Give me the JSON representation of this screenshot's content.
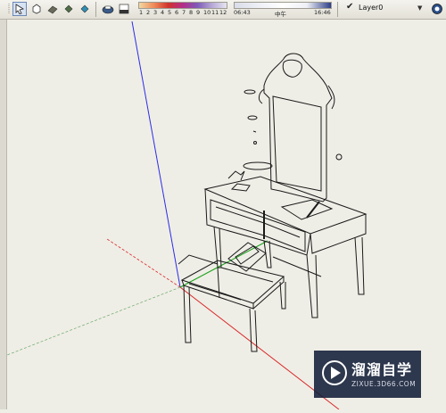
{
  "toolbar": {
    "tools": [
      {
        "name": "select-tool-icon",
        "active": true
      },
      {
        "name": "make-component-icon",
        "active": false
      },
      {
        "name": "paint-bucket-icon",
        "active": false
      },
      {
        "name": "style-icon",
        "active": false
      },
      {
        "name": "style-icon-2",
        "active": false
      }
    ],
    "shadow_buttons": [
      "shadows-toggle-icon",
      "shadow-settings-icon"
    ],
    "months": [
      "1",
      "2",
      "3",
      "4",
      "5",
      "6",
      "7",
      "8",
      "9",
      "10",
      "11",
      "12"
    ],
    "time_start": "06:43",
    "time_mid": "中午",
    "time_end": "16:46"
  },
  "layer": {
    "active_name": "Layer0",
    "check": "✔"
  },
  "watermark": {
    "title": "溜溜自学",
    "url": "ZIXUE.3D66.COM"
  }
}
